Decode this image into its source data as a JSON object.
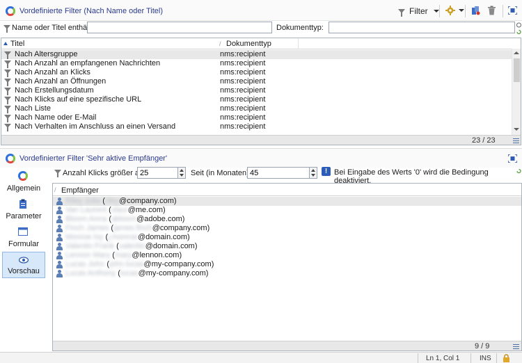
{
  "top_panel": {
    "title": "Vordefinierte Filter (Nach Name oder Titel)",
    "toolbar": {
      "filter_label": "Filter"
    },
    "filter_row": {
      "name_label": "Name oder Titel enthält:",
      "name_value": "",
      "doc_type_label": "Dokumenttyp:",
      "doc_type_value": ""
    },
    "table": {
      "columns": [
        "Titel",
        "Dokumenttyp"
      ],
      "rows": [
        {
          "title": "Nach Altersgruppe",
          "type": "nms:recipient",
          "selected": true
        },
        {
          "title": "Nach Anzahl an empfangenen Nachrichten",
          "type": "nms:recipient"
        },
        {
          "title": "Nach Anzahl an Klicks",
          "type": "nms:recipient"
        },
        {
          "title": "Nach Anzahl an Öffnungen",
          "type": "nms:recipient"
        },
        {
          "title": "Nach Erstellungsdatum",
          "type": "nms:recipient"
        },
        {
          "title": "Nach Klicks auf eine spezifische URL",
          "type": "nms:recipient"
        },
        {
          "title": "Nach Liste",
          "type": "nms:recipient"
        },
        {
          "title": "Nach Name oder E-Mail",
          "type": "nms:recipient"
        },
        {
          "title": "Nach Verhalten im Anschluss an einen Versand",
          "type": "nms:recipient"
        }
      ],
      "count": "23 / 23"
    }
  },
  "bottom_panel": {
    "title": "Vordefinierter Filter 'Sehr aktive Empfänger'",
    "nav": [
      {
        "label": "Allgemein",
        "icon": "logo-icon"
      },
      {
        "label": "Parameter",
        "icon": "clipboard-icon"
      },
      {
        "label": "Formular",
        "icon": "window-icon"
      },
      {
        "label": "Vorschau",
        "icon": "eye-icon",
        "active": true
      }
    ],
    "params": {
      "clicks_label": "Anzahl Klicks größer als:",
      "clicks_value": "25",
      "months_label": "Seit (in Monaten):",
      "months_value": "45",
      "info_text": "Bei Eingabe des Werts '0' wird die Bedingung deaktiviert."
    },
    "table": {
      "column": "Empfänger",
      "rows": [
        {
          "name": "Riley Julia",
          "local": "riley",
          "domain": "@company.com",
          "selected": true
        },
        {
          "name": "Van Laurent",
          "local": "vlaur",
          "domain": "@me.com"
        },
        {
          "name": "Bloom Anna",
          "local": "abloom",
          "domain": "@adobe.com"
        },
        {
          "name": "Finch James",
          "local": "james.finch",
          "domain": "@company.com"
        },
        {
          "name": "Monroe Ivy",
          "local": "j.monroe",
          "domain": "@domain.com"
        },
        {
          "name": "Valentin Frank",
          "local": "valentin",
          "domain": "@domain.com"
        },
        {
          "name": "Lennon Mary",
          "local": "mary",
          "domain": "@lennon.com"
        },
        {
          "name": "Lucas John",
          "local": "john.lucas",
          "domain": "@my-company.com"
        },
        {
          "name": "Lucas Anthony",
          "local": "lucas",
          "domain": "@my-company.com"
        }
      ],
      "count": "9 / 9"
    }
  },
  "status_bar": {
    "position": "Ln 1, Col 1",
    "mode": "INS"
  },
  "colors": {
    "accent": "#2a3a8c",
    "selection": "#d7e8fa",
    "info": "#2b5cb8"
  }
}
